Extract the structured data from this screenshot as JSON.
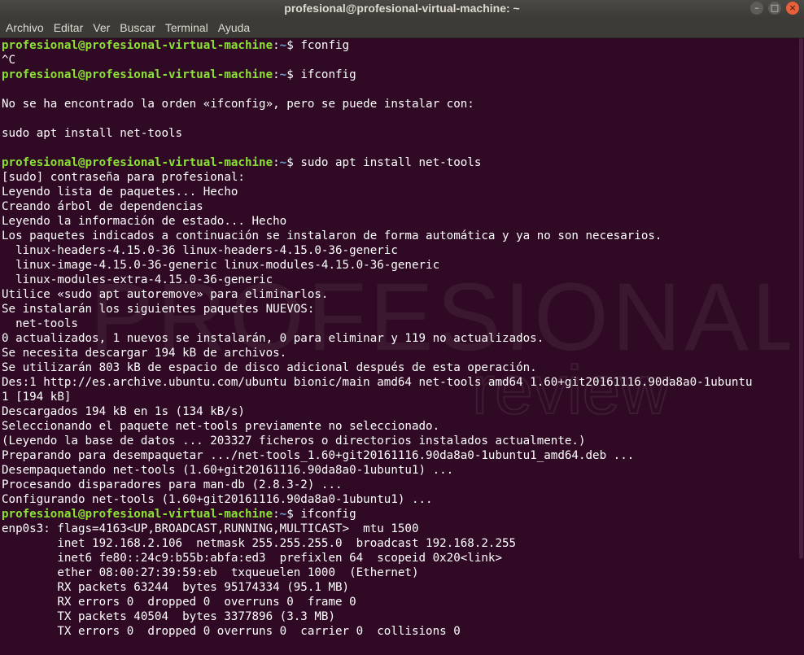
{
  "window": {
    "title": "profesional@profesional-virtual-machine: ~",
    "controls": {
      "minimize": "–",
      "maximize": "□",
      "close": "×"
    }
  },
  "menu": [
    "Archivo",
    "Editar",
    "Ver",
    "Buscar",
    "Terminal",
    "Ayuda"
  ],
  "prompt": {
    "user_host": "profesional@profesional-virtual-machine",
    "sep": ":",
    "dir": "~",
    "symbol": "$ "
  },
  "watermark": {
    "word1": "PROFESIONAL",
    "word2": "review"
  },
  "lines": [
    {
      "type": "prompt",
      "cmd": "fconfig"
    },
    {
      "type": "text",
      "text": "^C"
    },
    {
      "type": "prompt",
      "cmd": "ifconfig"
    },
    {
      "type": "text",
      "text": ""
    },
    {
      "type": "text",
      "text": "No se ha encontrado la orden «ifconfig», pero se puede instalar con:"
    },
    {
      "type": "text",
      "text": ""
    },
    {
      "type": "text",
      "text": "sudo apt install net-tools"
    },
    {
      "type": "text",
      "text": ""
    },
    {
      "type": "prompt",
      "cmd": "sudo apt install net-tools"
    },
    {
      "type": "text",
      "text": "[sudo] contraseña para profesional:"
    },
    {
      "type": "text",
      "text": "Leyendo lista de paquetes... Hecho"
    },
    {
      "type": "text",
      "text": "Creando árbol de dependencias"
    },
    {
      "type": "text",
      "text": "Leyendo la información de estado... Hecho"
    },
    {
      "type": "text",
      "text": "Los paquetes indicados a continuación se instalaron de forma automática y ya no son necesarios."
    },
    {
      "type": "text",
      "text": "  linux-headers-4.15.0-36 linux-headers-4.15.0-36-generic"
    },
    {
      "type": "text",
      "text": "  linux-image-4.15.0-36-generic linux-modules-4.15.0-36-generic"
    },
    {
      "type": "text",
      "text": "  linux-modules-extra-4.15.0-36-generic"
    },
    {
      "type": "text",
      "text": "Utilice «sudo apt autoremove» para eliminarlos."
    },
    {
      "type": "text",
      "text": "Se instalarán los siguientes paquetes NUEVOS:"
    },
    {
      "type": "text",
      "text": "  net-tools"
    },
    {
      "type": "text",
      "text": "0 actualizados, 1 nuevos se instalarán, 0 para eliminar y 119 no actualizados."
    },
    {
      "type": "text",
      "text": "Se necesita descargar 194 kB de archivos."
    },
    {
      "type": "text",
      "text": "Se utilizarán 803 kB de espacio de disco adicional después de esta operación."
    },
    {
      "type": "text",
      "text": "Des:1 http://es.archive.ubuntu.com/ubuntu bionic/main amd64 net-tools amd64 1.60+git20161116.90da8a0-1ubuntu"
    },
    {
      "type": "text",
      "text": "1 [194 kB]"
    },
    {
      "type": "text",
      "text": "Descargados 194 kB en 1s (134 kB/s)"
    },
    {
      "type": "text",
      "text": "Seleccionando el paquete net-tools previamente no seleccionado."
    },
    {
      "type": "text",
      "text": "(Leyendo la base de datos ... 203327 ficheros o directorios instalados actualmente.)"
    },
    {
      "type": "text",
      "text": "Preparando para desempaquetar .../net-tools_1.60+git20161116.90da8a0-1ubuntu1_amd64.deb ..."
    },
    {
      "type": "text",
      "text": "Desempaquetando net-tools (1.60+git20161116.90da8a0-1ubuntu1) ..."
    },
    {
      "type": "text",
      "text": "Procesando disparadores para man-db (2.8.3-2) ..."
    },
    {
      "type": "text",
      "text": "Configurando net-tools (1.60+git20161116.90da8a0-1ubuntu1) ..."
    },
    {
      "type": "prompt",
      "cmd": "ifconfig"
    },
    {
      "type": "text",
      "text": "enp0s3: flags=4163<UP,BROADCAST,RUNNING,MULTICAST>  mtu 1500"
    },
    {
      "type": "text",
      "text": "        inet 192.168.2.106  netmask 255.255.255.0  broadcast 192.168.2.255"
    },
    {
      "type": "text",
      "text": "        inet6 fe80::24c9:b55b:abfa:ed3  prefixlen 64  scopeid 0x20<link>"
    },
    {
      "type": "text",
      "text": "        ether 08:00:27:39:59:eb  txqueuelen 1000  (Ethernet)"
    },
    {
      "type": "text",
      "text": "        RX packets 63244  bytes 95174334 (95.1 MB)"
    },
    {
      "type": "text",
      "text": "        RX errors 0  dropped 0  overruns 0  frame 0"
    },
    {
      "type": "text",
      "text": "        TX packets 40504  bytes 3377896 (3.3 MB)"
    },
    {
      "type": "text",
      "text": "        TX errors 0  dropped 0 overruns 0  carrier 0  collisions 0"
    }
  ]
}
